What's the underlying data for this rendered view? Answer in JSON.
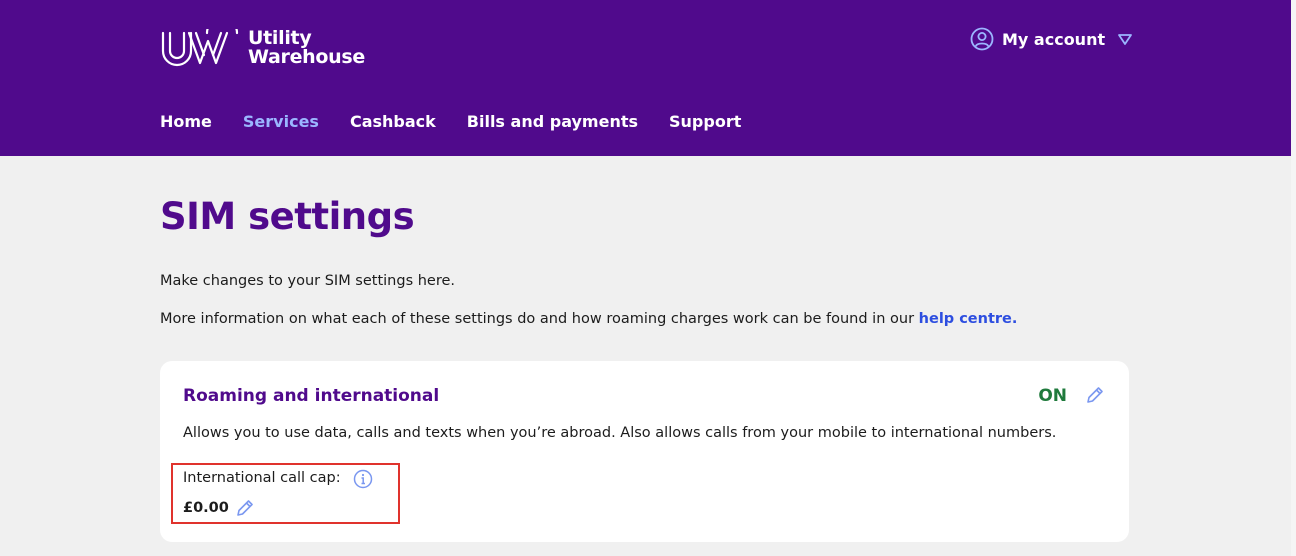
{
  "brand": {
    "logo_text_line1": "Utility",
    "logo_text_line2": "Warehouse",
    "header_color": "#500a8c",
    "accent_color": "#9bb6ff",
    "logo_icon": "uw-logo-icon"
  },
  "account": {
    "label": "My account",
    "icon": "user-circle-icon",
    "chevron": "chevron-down-icon"
  },
  "nav": {
    "items": [
      {
        "label": "Home",
        "active": false
      },
      {
        "label": "Services",
        "active": true
      },
      {
        "label": "Cashback",
        "active": false
      },
      {
        "label": "Bills and payments",
        "active": false
      },
      {
        "label": "Support",
        "active": false
      }
    ]
  },
  "page": {
    "title": "SIM settings",
    "intro1": "Make changes to your SIM settings here.",
    "intro2_prefix": "More information on what each of these settings do and how roaming charges work can be found in our ",
    "intro2_link": "help centre."
  },
  "roaming_card": {
    "title": "Roaming and international",
    "status": "ON",
    "status_color": "#1f7a3c",
    "description": "Allows you to use data, calls and texts when you’re abroad. Also allows calls from your mobile to international numbers.",
    "edit_icon": "pencil-icon",
    "call_cap_label": "International call cap:",
    "call_cap_info_icon": "info-icon",
    "call_cap_value": "£0.00",
    "highlight_color": "#e0332d"
  }
}
